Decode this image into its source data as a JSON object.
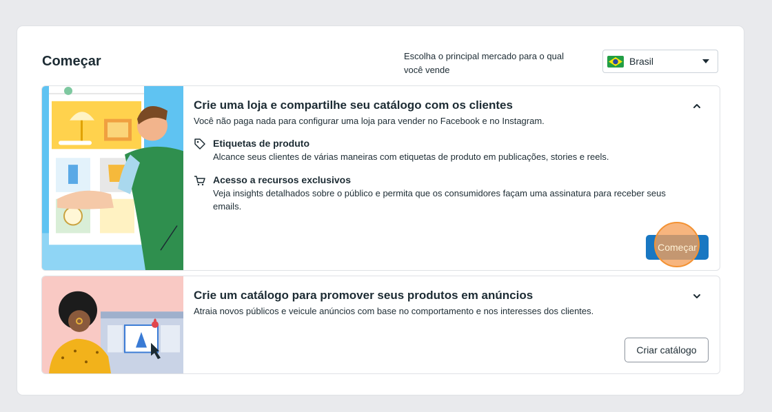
{
  "page": {
    "title": "Começar"
  },
  "market": {
    "label": "Escolha o principal mercado para o qual você vende",
    "selected": "Brasil"
  },
  "shop_card": {
    "title": "Crie uma loja e compartilhe seu catálogo com os clientes",
    "description": "Você não paga nada para configurar uma loja para vender no Facebook e no Instagram.",
    "features": [
      {
        "icon": "tag-icon",
        "title": "Etiquetas de produto",
        "description": "Alcance seus clientes de várias maneiras com etiquetas de produto em publicações, stories e reels."
      },
      {
        "icon": "cart-icon",
        "title": "Acesso a recursos exclusivos",
        "description": "Veja insights detalhados sobre o público e permita que os consumidores façam uma assinatura para receber seus emails."
      }
    ],
    "button_label": "Começar",
    "expanded": true
  },
  "catalog_card": {
    "title": "Crie um catálogo para promover seus produtos em anúncios",
    "description": "Atraia novos públicos e veicule anúncios com base no comportamento e nos interesses dos clientes.",
    "button_label": "Criar catálogo",
    "expanded": false
  },
  "colors": {
    "primary": "#1877c2",
    "highlight": "#f39233",
    "background": "#e9eaed"
  }
}
